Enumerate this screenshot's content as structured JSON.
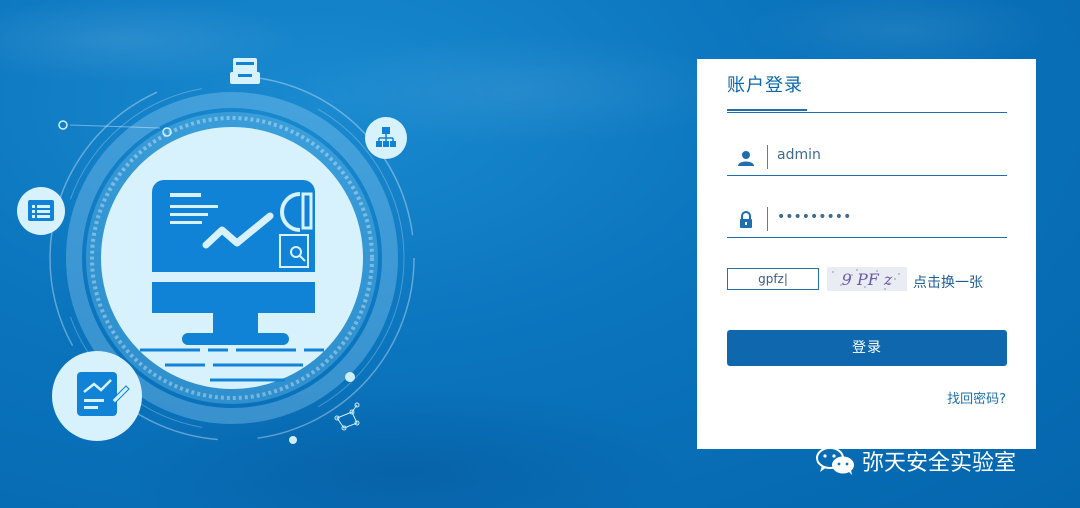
{
  "login": {
    "title": "账户登录",
    "username": {
      "value": "admin",
      "icon": "user-icon"
    },
    "password": {
      "masked_value": "•••••••••",
      "icon": "lock-icon"
    },
    "captcha": {
      "input_value": "gpfz|",
      "image_text": "9 PF z",
      "refresh_label": "点击换一张"
    },
    "submit_label": "登录",
    "forgot_label": "找回密码?"
  },
  "watermark": {
    "text": "弥天安全实验室",
    "icon": "wechat-icon"
  },
  "illustration": {
    "icons": [
      "document-tray-icon",
      "org-chart-icon",
      "list-icon",
      "report-chart-icon",
      "monitor-chart-icon"
    ]
  },
  "colors": {
    "background": "#0a74bd",
    "accent": "#0f68ae",
    "card": "#ffffff"
  }
}
